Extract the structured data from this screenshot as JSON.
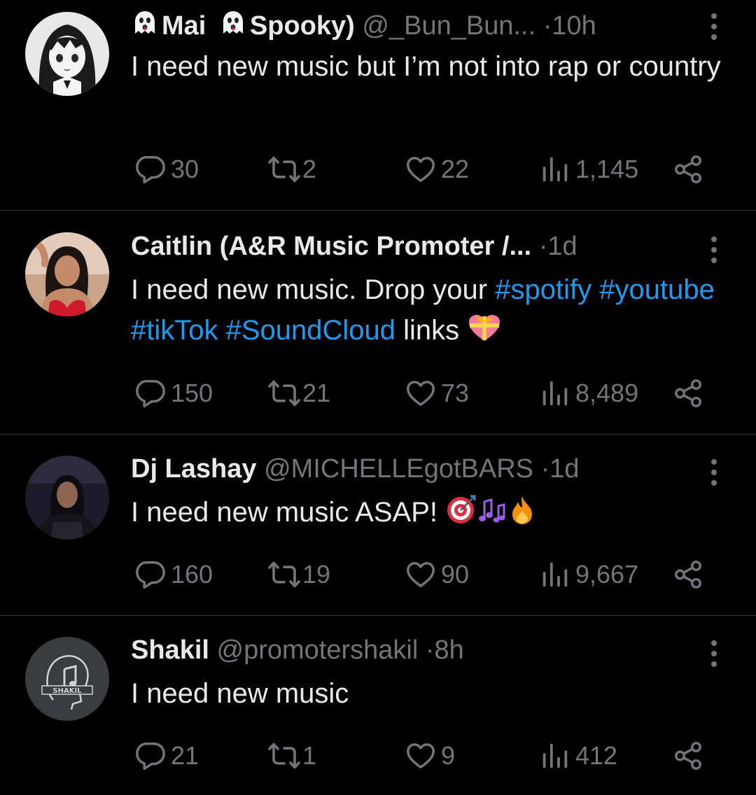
{
  "tweets": [
    {
      "name": "Mai",
      "name_suffix": "Spooky)",
      "handle": "@_Bun_Bun...",
      "time": "10h",
      "text": "I need new music but I’m not into rap or country",
      "replies": "30",
      "retweets": "2",
      "likes": "22",
      "views": "1,145"
    },
    {
      "name": "Caitlin (A&R Music Promoter /...",
      "time": "1d",
      "text_before": "I need new music. Drop your ",
      "hashtags": [
        "#spotify",
        "#youtube",
        "#tikTok",
        "#SoundCloud"
      ],
      "text_after": " links",
      "replies": "150",
      "retweets": "21",
      "likes": "73",
      "views": "8,489"
    },
    {
      "name": "Dj Lashay",
      "handle": "@MICHELLEgotBARS",
      "time": "1d",
      "text": "I need new music ASAP!",
      "replies": "160",
      "retweets": "19",
      "likes": "90",
      "views": "9,667"
    },
    {
      "name": "Shakil",
      "handle": "@promotershakil",
      "time": "8h",
      "text": "I need new music",
      "avatar_text": "SHAKIL",
      "replies": "21",
      "retweets": "1",
      "likes": "9",
      "views": "412"
    }
  ],
  "icons": {
    "reply": "reply-icon",
    "retweet": "retweet-icon",
    "like": "heart-icon",
    "views": "views-icon",
    "share": "share-icon",
    "more": "more-icon"
  },
  "colors": {
    "background": "#000000",
    "text": "#e7e9ea",
    "muted": "#71767b",
    "hashtag": "#1d9bf0",
    "divider": "#2f3336"
  }
}
